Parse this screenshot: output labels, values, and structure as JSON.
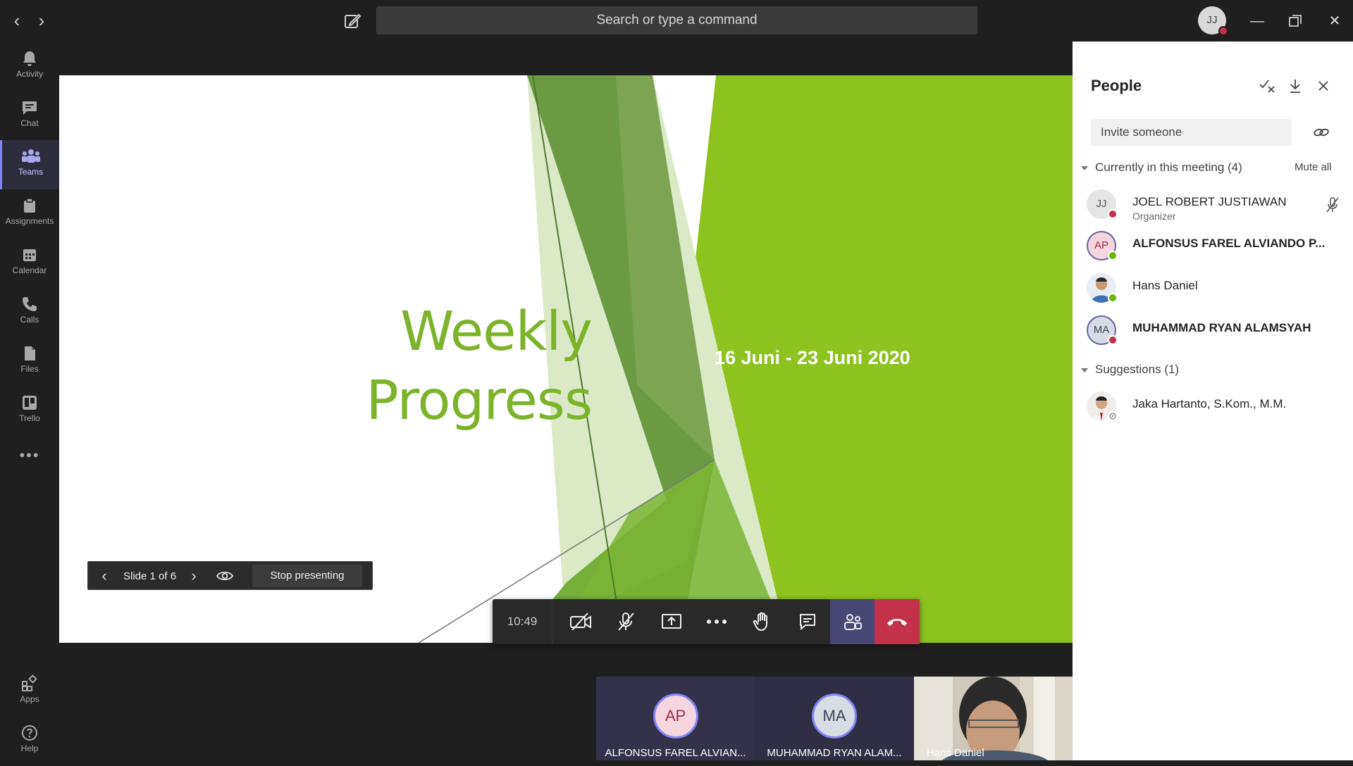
{
  "topbar": {
    "back_icon": "chevron-left-icon",
    "forward_icon": "chevron-right-icon",
    "search_placeholder": "Search or type a command",
    "user_initials": "JJ",
    "status_color": "#c4314b"
  },
  "rail": {
    "items": [
      {
        "label": "Activity",
        "icon": "bell-icon"
      },
      {
        "label": "Chat",
        "icon": "chat-icon"
      },
      {
        "label": "Teams",
        "icon": "teams-icon",
        "active": true
      },
      {
        "label": "Assignments",
        "icon": "assignments-icon"
      },
      {
        "label": "Calendar",
        "icon": "calendar-icon"
      },
      {
        "label": "Calls",
        "icon": "phone-icon"
      },
      {
        "label": "Files",
        "icon": "files-icon"
      },
      {
        "label": "Trello",
        "icon": "trello-icon"
      },
      {
        "label": "Apps",
        "icon": "apps-icon"
      },
      {
        "label": "Help",
        "icon": "help-icon"
      }
    ],
    "more_icon": "more-icon"
  },
  "slide": {
    "title_line1": "Weekly",
    "title_line2": "Progress",
    "date_range": "16 Juni - 23 Juni 2020",
    "accent_color": "#8dc21f",
    "title_color": "#7cb32a"
  },
  "slide_controls": {
    "counter": "Slide 1 of 6",
    "stop_label": "Stop presenting"
  },
  "callbar": {
    "elapsed": "10:49",
    "people_bg": "#464775",
    "hangup_bg": "#c4314b"
  },
  "tiles": [
    {
      "initials": "AP",
      "name": "ALFONSUS FAREL ALVIAN..."
    },
    {
      "initials": "MA",
      "name": "MUHAMMAD RYAN ALAM..."
    },
    {
      "name": "Hans Daniel"
    }
  ],
  "panel": {
    "title": "People",
    "invite_placeholder": "Invite someone",
    "meeting_section": "Currently in this meeting (4)",
    "mute_all": "Mute all",
    "suggestions_section": "Suggestions (1)",
    "participants": [
      {
        "initials": "JJ",
        "name": "JOEL ROBERT JUSTIAWAN",
        "role": "Organizer",
        "status": "busy"
      },
      {
        "initials": "AP",
        "name": "ALFONSUS FAREL ALVIANDO P...",
        "status": "available"
      },
      {
        "name": "Hans Daniel",
        "status": "available"
      },
      {
        "initials": "MA",
        "name": "MUHAMMAD RYAN ALAMSYAH",
        "status": "busy"
      }
    ],
    "suggestions": [
      {
        "name": "Jaka Hartanto, S.Kom., M.M.",
        "status": "offline"
      }
    ]
  }
}
